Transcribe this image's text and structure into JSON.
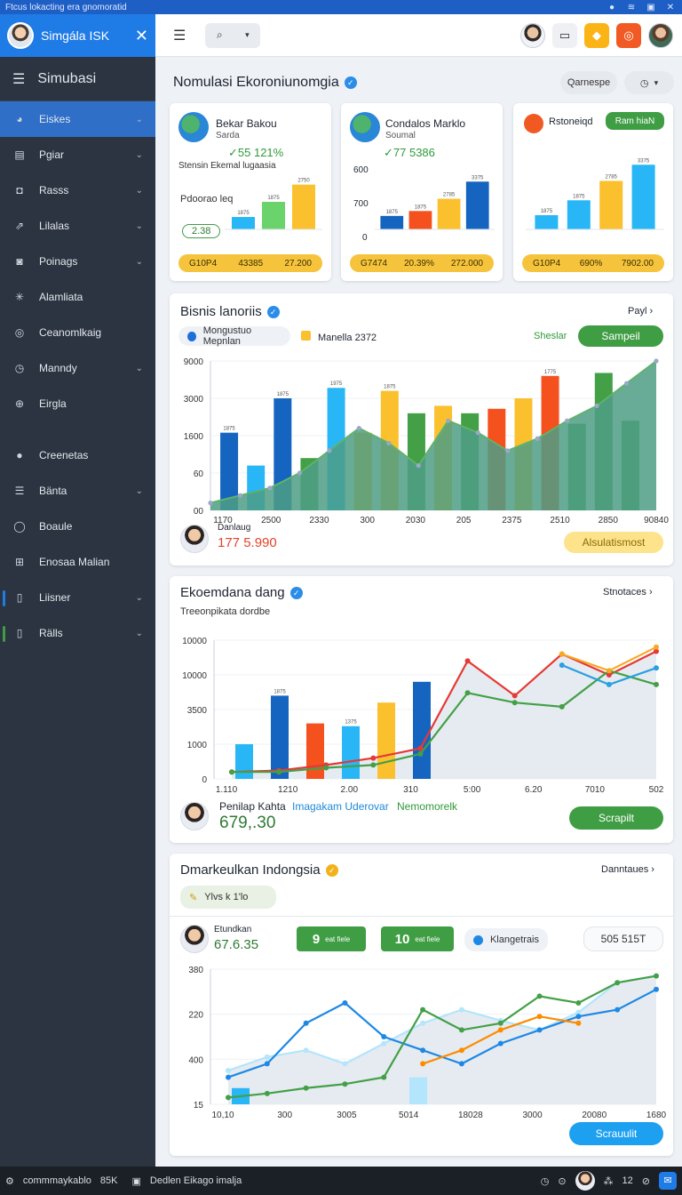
{
  "system_bar": {
    "title": "Ftcus lokacting era gnomoratid"
  },
  "sidebar": {
    "user_name": "Simgála ISK",
    "title": "Simubasi",
    "items": [
      {
        "label": "Eiskes",
        "icon": "person-icon",
        "has_chevron": true,
        "active": true
      },
      {
        "label": "Pgiar",
        "icon": "grid-icon",
        "has_chevron": true
      },
      {
        "label": "Rasss",
        "icon": "tag-icon",
        "has_chevron": true
      },
      {
        "label": "Lilalas",
        "icon": "share-icon",
        "has_chevron": true
      },
      {
        "label": "Poinags",
        "icon": "car-icon",
        "has_chevron": true
      },
      {
        "label": "Alamliata",
        "icon": "gear-icon",
        "has_chevron": false
      },
      {
        "label": "Ceanomlkaig",
        "icon": "coin-icon",
        "has_chevron": false
      },
      {
        "label": "Manndy",
        "icon": "clock-icon",
        "has_chevron": true
      },
      {
        "label": "Eirgla",
        "icon": "globe-icon",
        "has_chevron": false
      },
      {
        "label": "Creenetas",
        "icon": "user-icon",
        "has_chevron": false
      },
      {
        "label": "Bänta",
        "icon": "list-icon",
        "has_chevron": true
      },
      {
        "label": "Boaule",
        "icon": "circle-icon",
        "has_chevron": false
      },
      {
        "label": "Enosaa Malian",
        "icon": "table-icon",
        "has_chevron": false
      },
      {
        "label": "Liisner",
        "icon": "doc-icon",
        "has_chevron": true,
        "marker": "#1f7be6"
      },
      {
        "label": "Rälls",
        "icon": "doc-icon",
        "has_chevron": true,
        "marker": "#3f9d44"
      }
    ]
  },
  "header": {
    "search_label": "Q"
  },
  "page": {
    "title": "Nomulasi Ekoroniunomgia",
    "pill_left": "Qarnespe",
    "pill_right": "◷"
  },
  "kpis": [
    {
      "name": "Bekar Bakou",
      "sub": "Sarda",
      "value": "✓55 121%",
      "desc": "Stensin Ekemal lugaasia",
      "label": "Pdoorao leq",
      "tag": "2.38",
      "strip": [
        "G10P4",
        "43385",
        "27.200"
      ]
    },
    {
      "name": "Condalos Marklo",
      "sub": "Soumal",
      "value": "✓77 5386",
      "axis": [
        "600",
        "700",
        "0"
      ],
      "strip": [
        "G7474",
        "20.39%",
        "272.000"
      ]
    },
    {
      "name": "Rstoneiqd",
      "button": "Ram hiaN",
      "strip": [
        "G10P4",
        "690%",
        "7902.00"
      ]
    }
  ],
  "chart1": {
    "title": "Bisnis lanoriis",
    "link": "Payl",
    "legend1": "Mongustuo Mepnlan",
    "legend2": "Manella 2372",
    "legend3": "Sheslar",
    "button": "Sampeil",
    "footer_label": "Danlaug",
    "footer_value": "177 5.990",
    "footer_button": "Alsulatismost"
  },
  "chart2": {
    "title": "Ekoemdana dang",
    "subtitle": "Treeonpikata dordbe",
    "link": "Stnotaces",
    "footer_label": "Penilap Kahta",
    "footer_value": "679,.30",
    "footer_legend_blue": "Imagakam Uderovar",
    "footer_legend_green": "Nemomorelk",
    "button": "Scrapilt"
  },
  "chart3": {
    "title": "Dmarkeulkan Indongsia",
    "link": "Danntaues",
    "chip": "Ylvs k  1'lo",
    "person_label": "Etundkan",
    "person_value": "67.6.35",
    "badge1_num": "9",
    "badge1_txt": "eat fiele",
    "badge2_num": "10",
    "badge2_txt": "eat fiele",
    "legend": "Klangetrais",
    "stat": "505 515T",
    "button": "Scrauulit"
  },
  "chart_data": [
    {
      "type": "bar",
      "title": "",
      "categories": [
        "a",
        "b",
        "c"
      ],
      "values": [
        18,
        40,
        65
      ],
      "data_labels": [
        "1875",
        "1875",
        "2750"
      ],
      "ylim": [
        0,
        80
      ]
    },
    {
      "type": "bar",
      "title": "",
      "categories": [
        "a",
        "b",
        "c",
        "d"
      ],
      "values": [
        22,
        30,
        50,
        78
      ],
      "data_labels": [
        "1875",
        "1875",
        "2785",
        "3375"
      ],
      "ylim": [
        0,
        90
      ]
    },
    {
      "type": "bar",
      "title": "",
      "categories": [
        "a",
        "b",
        "c",
        "d"
      ],
      "values": [
        22,
        45,
        75,
        100
      ],
      "data_labels": [
        "1875",
        "1875",
        "2785",
        "3375"
      ],
      "ylim": [
        0,
        110
      ]
    },
    {
      "type": "bar",
      "title": "Bisnis lanoriis",
      "yticks": [
        "9000",
        "3000",
        "1600",
        "60",
        "00"
      ],
      "xticks": [
        "1170",
        "2500",
        "2330",
        "300",
        "2030",
        "205",
        "2375",
        "2510",
        "2850",
        "90840"
      ],
      "ylim": [
        0,
        100
      ],
      "bars": [
        {
          "v": 52,
          "c": "#1565c0",
          "lbl": "1875"
        },
        {
          "v": 30,
          "c": "#29b6f6"
        },
        {
          "v": 75,
          "c": "#1565c0",
          "lbl": "1875"
        },
        {
          "v": 35,
          "c": "#43a047"
        },
        {
          "v": 82,
          "c": "#29b6f6",
          "lbl": "1975"
        },
        {
          "v": 52,
          "c": "#fbc02d"
        },
        {
          "v": 80,
          "c": "#fbc02d",
          "lbl": "1875"
        },
        {
          "v": 65,
          "c": "#43a047"
        },
        {
          "v": 70,
          "c": "#fbc02d"
        },
        {
          "v": 65,
          "c": "#43a047"
        },
        {
          "v": 68,
          "c": "#f4511e"
        },
        {
          "v": 75,
          "c": "#fbc02d"
        },
        {
          "v": 90,
          "c": "#f4511e",
          "lbl": "1775"
        },
        {
          "v": 58,
          "c": "#43a047"
        },
        {
          "v": 92,
          "c": "#43a047"
        },
        {
          "v": 60,
          "c": "#43a047"
        }
      ],
      "area": [
        5,
        10,
        15,
        25,
        40,
        55,
        45,
        30,
        60,
        52,
        40,
        48,
        60,
        70,
        85,
        100
      ]
    },
    {
      "type": "line",
      "title": "Ekoemdana dang",
      "yticks": [
        "10000",
        "10000",
        "3500",
        "1000",
        "0"
      ],
      "xticks": [
        "1.110",
        "1210",
        "2.00",
        "310",
        "5:00",
        "6.20",
        "7010",
        "502"
      ],
      "ylim": [
        0,
        100
      ],
      "bars": [
        {
          "x": 1,
          "v": 25,
          "c": "#29b6f6"
        },
        {
          "x": 2,
          "v": 60,
          "c": "#1565c0",
          "lbl": "1875"
        },
        {
          "x": 3,
          "v": 40,
          "c": "#f4511e"
        },
        {
          "x": 4,
          "v": 38,
          "c": "#29b6f6",
          "lbl": "1375"
        },
        {
          "x": 5,
          "v": 55,
          "c": "#fbc02d"
        },
        {
          "x": 6,
          "v": 70,
          "c": "#1565c0"
        }
      ],
      "series": [
        {
          "color": "#e53935",
          "values": [
            5,
            6,
            10,
            15,
            22,
            85,
            60,
            90,
            75,
            92
          ]
        },
        {
          "color": "#43a047",
          "values": [
            5,
            5,
            8,
            10,
            18,
            62,
            55,
            52,
            78,
            68
          ]
        },
        {
          "color": "#f9a825",
          "values": [
            null,
            null,
            null,
            null,
            null,
            null,
            null,
            90,
            78,
            95
          ]
        },
        {
          "color": "#29a0e0",
          "values": [
            null,
            null,
            null,
            null,
            null,
            null,
            null,
            82,
            68,
            80
          ]
        }
      ]
    },
    {
      "type": "line",
      "title": "Dmarkeulkan Indongsia",
      "yticks": [
        "380",
        "220",
        "400",
        "15"
      ],
      "xticks": [
        "10,10",
        "300",
        "3005",
        "5014",
        "18028",
        "3000",
        "20080",
        "1680"
      ],
      "ylim": [
        0,
        100
      ],
      "bars": [
        {
          "x": 1,
          "v": 12,
          "c": "#29b6f6"
        },
        {
          "x": 6,
          "v": 20,
          "c": "#b3e5fc"
        }
      ],
      "series": [
        {
          "color": "#b3e5fc",
          "values": [
            25,
            35,
            40,
            30,
            45,
            60,
            70,
            62,
            55,
            68,
            90,
            95
          ]
        },
        {
          "color": "#1e88e5",
          "values": [
            20,
            30,
            60,
            75,
            50,
            40,
            30,
            45,
            55,
            65,
            70,
            85
          ]
        },
        {
          "color": "#43a047",
          "values": [
            5,
            8,
            12,
            15,
            20,
            70,
            55,
            60,
            80,
            75,
            90,
            95
          ]
        },
        {
          "color": "#fb8c00",
          "values": [
            null,
            null,
            null,
            null,
            null,
            30,
            40,
            55,
            65,
            60,
            null,
            null
          ]
        }
      ]
    }
  ],
  "taskbar": {
    "left": "commmaykablo",
    "num": "85K",
    "center": "Dedlen Eikago imalja",
    "right": "12"
  }
}
